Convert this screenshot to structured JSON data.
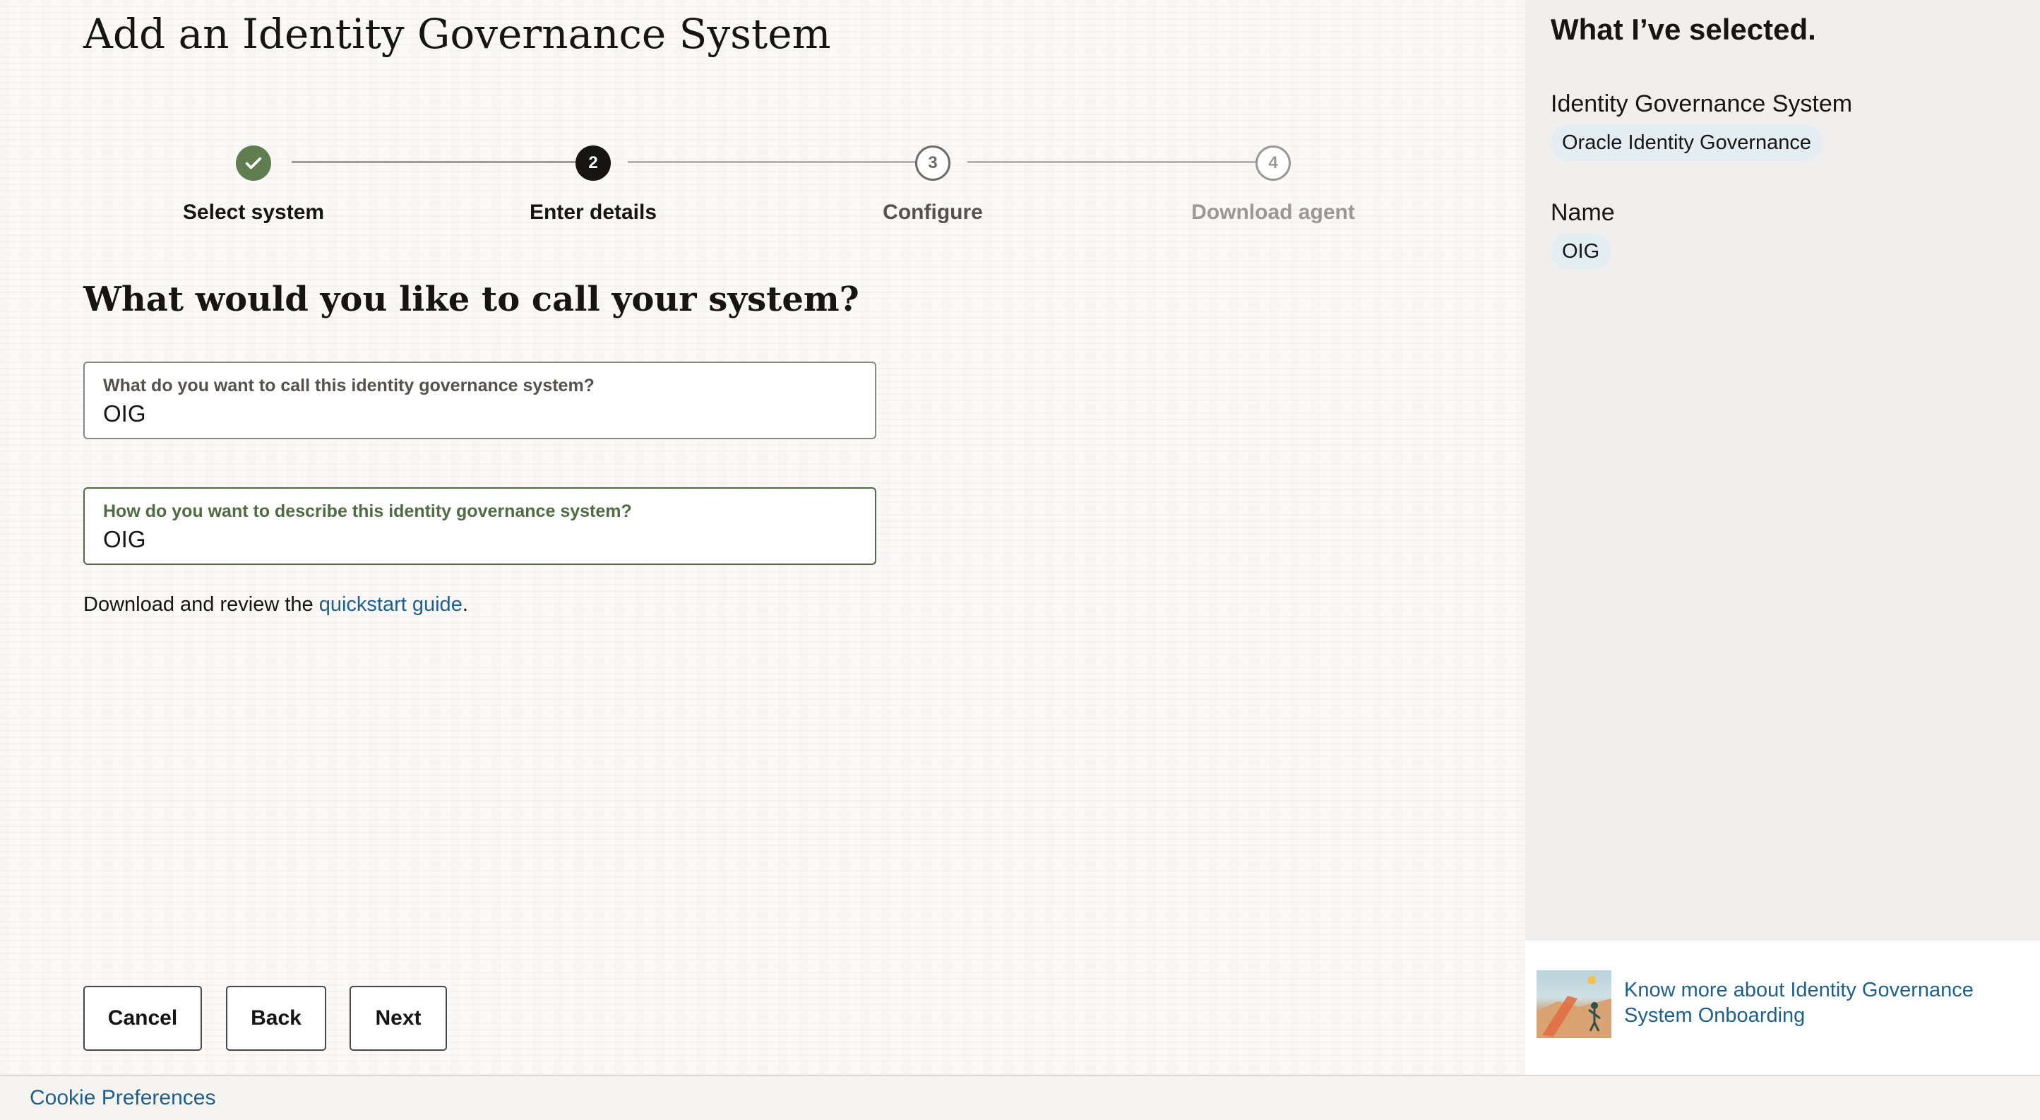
{
  "page": {
    "title": "Add an Identity Governance System"
  },
  "stepper": {
    "steps": [
      {
        "label": "Select system",
        "number": "",
        "state": "completed",
        "icon": "checkmark-icon"
      },
      {
        "label": "Enter details",
        "number": "2",
        "state": "current"
      },
      {
        "label": "Configure",
        "number": "3",
        "state": "upcoming"
      },
      {
        "label": "Download agent",
        "number": "4",
        "state": "upcoming"
      }
    ]
  },
  "form": {
    "heading": "What would you like to call your system?",
    "name_field": {
      "label": "What do you want to call this identity governance system?",
      "value": "OIG"
    },
    "description_field": {
      "label": "How do you want to describe this identity governance system?",
      "value": "OIG"
    },
    "guide_prefix": "Download and review the ",
    "guide_link": "quickstart guide",
    "guide_suffix": "."
  },
  "buttons": {
    "cancel": "Cancel",
    "back": "Back",
    "next": "Next"
  },
  "summary_panel": {
    "title": "What I’ve selected.",
    "items": [
      {
        "label": "Identity Governance System",
        "value": "Oracle Identity Governance"
      },
      {
        "label": "Name",
        "value": "OIG"
      }
    ]
  },
  "help": {
    "link": "Know more about Identity Governance System Onboarding"
  },
  "footer": {
    "cookie_link": "Cookie Preferences"
  },
  "colors": {
    "completed": "#5f7d4f",
    "current": "#161513",
    "link": "#1f5f8b",
    "chip": "#e4edf1"
  }
}
